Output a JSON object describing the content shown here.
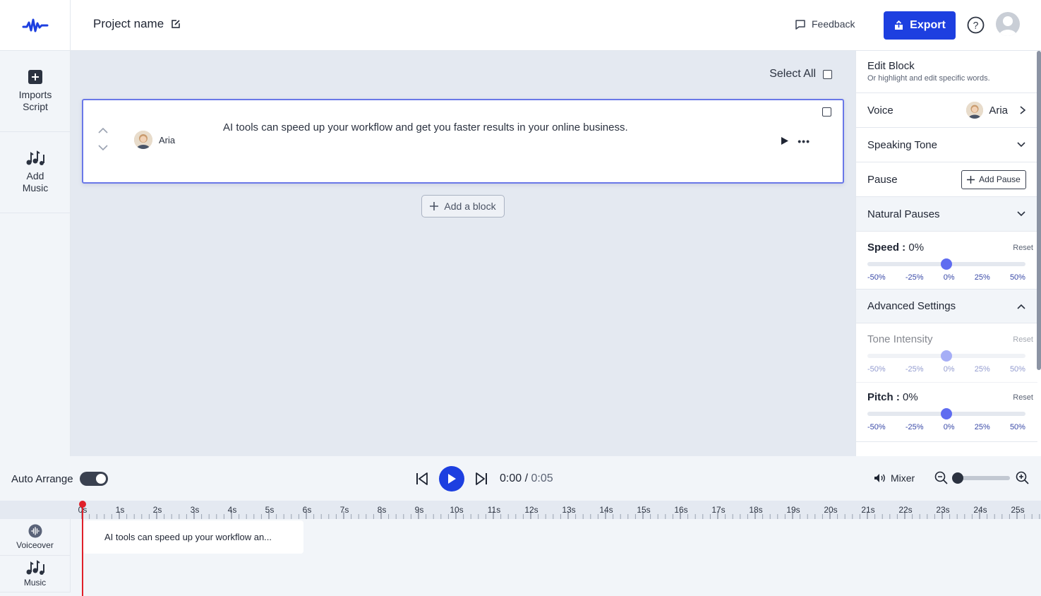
{
  "header": {
    "project_name": "Project name",
    "feedback_label": "Feedback",
    "export_label": "Export"
  },
  "sidebar": {
    "items": [
      {
        "label": "Imports Script",
        "icon": "plus-square-icon"
      },
      {
        "label": "Add Music",
        "icon": "music-notes-icon"
      }
    ]
  },
  "editor": {
    "select_all_label": "Select All",
    "block": {
      "speaker": "Aria",
      "text": "AI tools can speed up your workflow and get you faster results in your online business."
    },
    "add_block_label": "Add a block"
  },
  "panel": {
    "edit_block_title": "Edit Block",
    "edit_block_subtitle": "Or highlight and edit specific words.",
    "voice_label": "Voice",
    "voice_value": "Aria",
    "speaking_tone_label": "Speaking Tone",
    "pause_label": "Pause",
    "add_pause_label": "Add Pause",
    "natural_pauses_label": "Natural Pauses",
    "speed": {
      "label": "Speed :",
      "value": "0%",
      "reset": "Reset",
      "level": 0.5
    },
    "advanced_settings_label": "Advanced Settings",
    "tone_intensity": {
      "label": "Tone Intensity",
      "reset": "Reset",
      "level": 0.5
    },
    "pitch": {
      "label": "Pitch :",
      "value": "0%",
      "reset": "Reset",
      "level": 0.5
    },
    "ticks": [
      "-50%",
      "-25%",
      "0%",
      "25%",
      "50%"
    ]
  },
  "transport": {
    "auto_arrange_label": "Auto Arrange",
    "current_time": "0:00",
    "separator": " / ",
    "duration": "0:05",
    "mixer_label": "Mixer"
  },
  "timeline": {
    "ruler_labels": [
      "0s",
      "1s",
      "2s",
      "3s",
      "4s",
      "5s",
      "6s",
      "7s",
      "8s",
      "9s",
      "10s",
      "11s",
      "12s",
      "13s",
      "14s",
      "15s",
      "16s",
      "17s",
      "18s",
      "19s",
      "20s",
      "21s",
      "22s",
      "23s",
      "24s",
      "25s"
    ],
    "tracks": [
      {
        "label": "Voiceover",
        "icon": "waveform-icon"
      },
      {
        "label": "Music",
        "icon": "music-notes-icon"
      }
    ],
    "clip_text": "AI tools can speed up your workflow an..."
  },
  "colors": {
    "accent": "#1d3fe0",
    "slider": "#5f6cf0",
    "playhead": "#e0202a"
  }
}
